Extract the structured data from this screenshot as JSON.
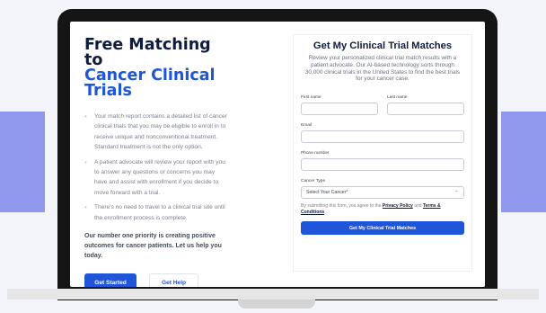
{
  "hero": {
    "title_line1": "Free Matching to",
    "title_line2": "Cancer Clinical",
    "title_line3": "Trials",
    "bullets": [
      "Your match report contains a detailed list of cancer clinical trials that you may be eligible to enroll in to receive unique and nonconventional treatment. Standard treatment is not the only option.",
      "A patient advocate will review your report with you to answer any questions or concerns you may have and assist with enrollment if you decide to move forward with a trial.",
      "There's no need to travel to a clinical trial site until the enrollment process is complete."
    ],
    "priority_text": "Our number one priority is creating positive outcomes for cancer patients. Let us help you today.",
    "get_started_label": "Get Started",
    "get_help_label": "Get Help"
  },
  "form": {
    "title": "Get My Clinical Trial Matches",
    "subtitle": "Review your personalized clinical trial match results with a patient advocate. Our AI-based technology sorts through 30,000 clinical trials in the United States to find the best trials for your cancer case.",
    "first_name_label": "First name",
    "last_name_label": "Last name",
    "email_label": "Email",
    "phone_label": "Phone number",
    "cancer_type_label": "Cancer Type",
    "cancer_type_value": "Select Your Cancer*",
    "consent_prefix": "By submitting this form, you agree to the",
    "privacy_link": "Privacy Policy",
    "consent_and": "and",
    "terms_link": "Terms & Conditions",
    "consent_end": ".",
    "submit_label": "Get My Clinical Trial Matches"
  },
  "colors": {
    "brand_blue": "#1f55d9",
    "navy": "#101c3d",
    "side_band": "#8f98ec"
  }
}
